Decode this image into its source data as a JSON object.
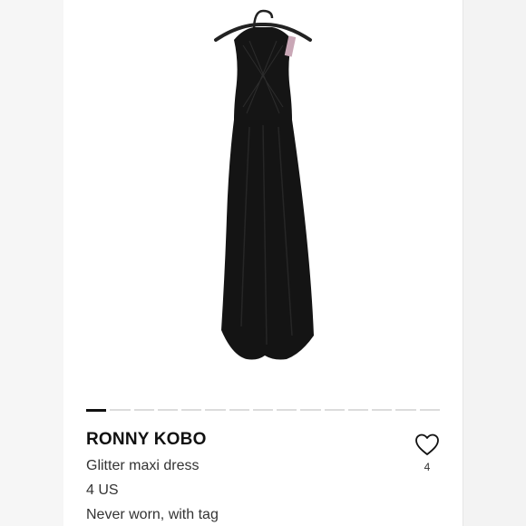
{
  "listing": {
    "brand": "RONNY KOBO",
    "title": "Glitter maxi dress",
    "size": "4 US",
    "condition": "Never worn, with tag",
    "likes": "4"
  },
  "carousel": {
    "total_images": 15,
    "active_index": 0
  },
  "icons": {
    "like": "heart-outline-icon"
  },
  "colors": {
    "dress": "#141414",
    "accent_dark": "#111111",
    "indicator_inactive": "#dcdcdc"
  }
}
